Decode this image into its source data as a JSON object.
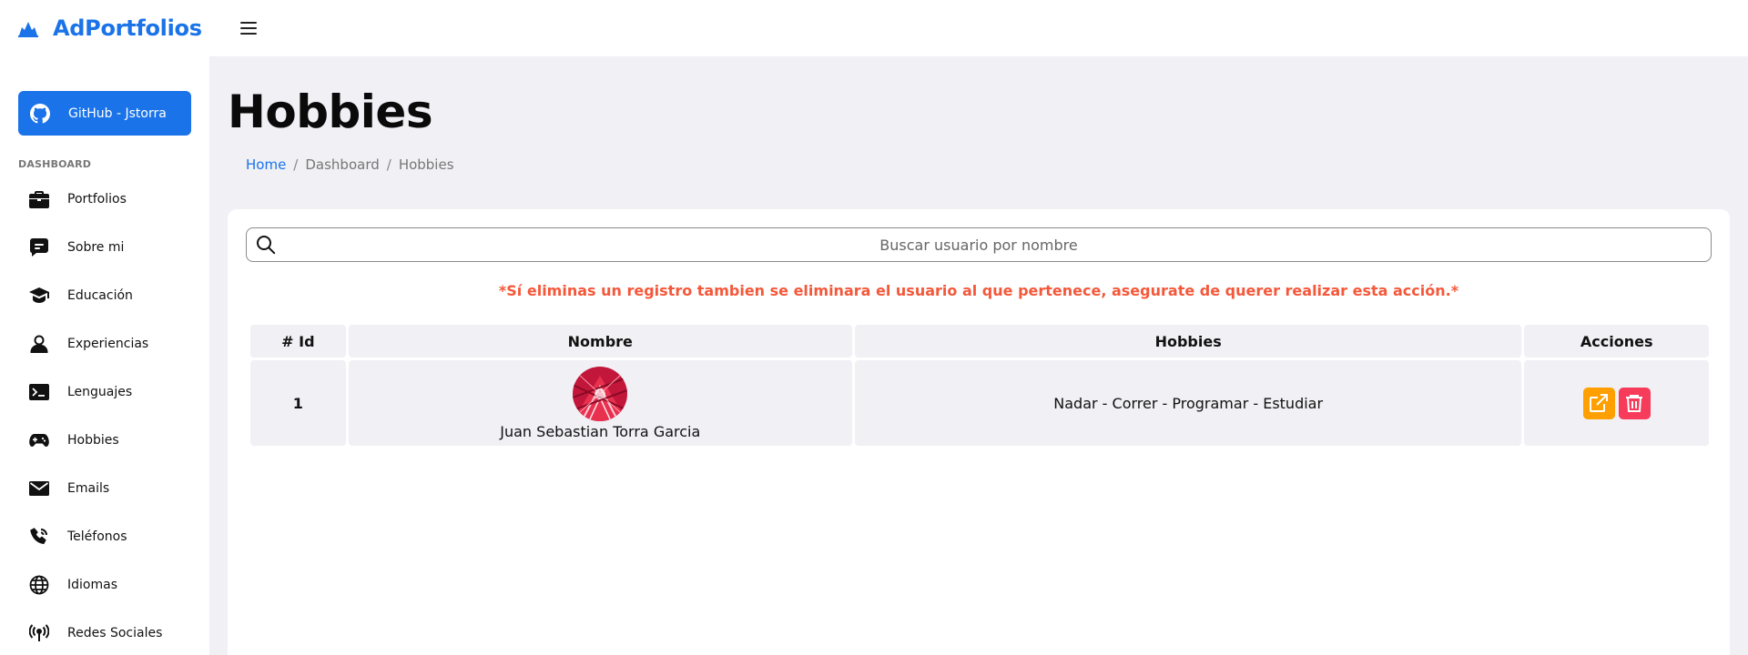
{
  "app": {
    "brand": "AdPortfolios"
  },
  "sidebar": {
    "github_label": "GitHub - Jstorra",
    "section_label": "DASHBOARD",
    "items": [
      {
        "label": "Portfolios",
        "icon": "briefcase-icon"
      },
      {
        "label": "Sobre mi",
        "icon": "chat-square-icon"
      },
      {
        "label": "Educación",
        "icon": "graduation-cap-icon"
      },
      {
        "label": "Experiencias",
        "icon": "person-icon"
      },
      {
        "label": "Lenguajes",
        "icon": "terminal-icon"
      },
      {
        "label": "Hobbies",
        "icon": "gamepad-icon"
      },
      {
        "label": "Emails",
        "icon": "envelope-icon"
      },
      {
        "label": "Teléfonos",
        "icon": "phone-icon"
      },
      {
        "label": "Idiomas",
        "icon": "globe-icon"
      },
      {
        "label": "Redes Sociales",
        "icon": "broadcast-icon"
      }
    ]
  },
  "main": {
    "title": "Hobbies",
    "breadcrumb": {
      "home": "Home",
      "separator": "/",
      "dashboard": "Dashboard",
      "current": "Hobbies"
    },
    "search": {
      "placeholder": "Buscar usuario por nombre"
    },
    "warning": "*Sí eliminas un registro tambien se eliminara el usuario al que pertenece, asegurate de querer realizar esta acción.*",
    "table": {
      "headers": [
        "# Id",
        "Nombre",
        "Hobbies",
        "Acciones"
      ],
      "rows": [
        {
          "id": "1",
          "name": "Juan Sebastian Torra Garcia",
          "hobbies": "Nadar - Correr - Programar - Estudiar"
        }
      ]
    }
  },
  "colors": {
    "accent": "#1a73e8",
    "warning": "#f4583a",
    "edit": "#ffa000",
    "delete": "#f73b5a"
  }
}
